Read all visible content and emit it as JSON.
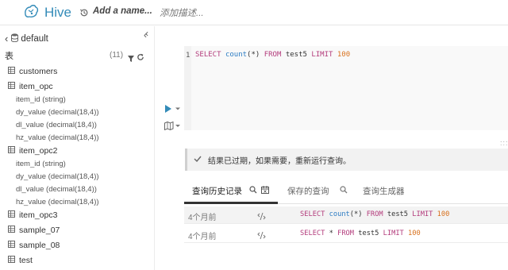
{
  "header": {
    "app_name": "Hive",
    "query_name_placeholder": "Add a name...",
    "description_placeholder": "添加描述..."
  },
  "sidebar": {
    "database": "default",
    "tables_label": "表",
    "tables_count": "(11)",
    "tables": [
      {
        "name": "customers"
      },
      {
        "name": "item_opc",
        "columns": [
          "item_id (string)",
          "dy_value (decimal(18,4))",
          "dl_value (decimal(18,4))",
          "hz_value (decimal(18,4))"
        ]
      },
      {
        "name": "item_opc2",
        "columns": [
          "item_id (string)",
          "dy_value (decimal(18,4))",
          "dl_value (decimal(18,4))",
          "hz_value (decimal(18,4))"
        ]
      },
      {
        "name": "item_opc3"
      },
      {
        "name": "sample_07"
      },
      {
        "name": "sample_08"
      },
      {
        "name": "test"
      }
    ]
  },
  "editor": {
    "line_number": "1",
    "tokens": [
      "SELECT",
      " ",
      "count",
      "(*) ",
      "FROM",
      " test5 ",
      "LIMIT",
      " ",
      "100"
    ]
  },
  "notice": {
    "text": "结果已过期，如果需要，重新运行查询。"
  },
  "tabs": [
    {
      "label": "查询历史记录"
    },
    {
      "label": "保存的查询"
    },
    {
      "label": "查询生成器"
    }
  ],
  "history": [
    {
      "time": "4个月前",
      "tokens": [
        "SELECT",
        " ",
        "count",
        "(*) ",
        "FROM",
        " test5 ",
        "LIMIT",
        " ",
        "100"
      ]
    },
    {
      "time": "4个月前",
      "tokens": [
        "SELECT",
        " * ",
        "FROM",
        " test5 ",
        "LIMIT",
        " ",
        "100"
      ]
    }
  ],
  "colors": {
    "brand": "#338bb8",
    "keyword": "#b33c7c",
    "function": "#2c7cc3",
    "number": "#d8721f"
  },
  "icons": [
    "hive-logo-icon",
    "history-icon",
    "chevron-left-icon",
    "database-icon",
    "filter-icon",
    "refresh-icon",
    "table-icon",
    "play-icon",
    "caret-down-icon",
    "map-icon",
    "check-icon",
    "search-icon",
    "calendar-icon",
    "code-icon"
  ]
}
